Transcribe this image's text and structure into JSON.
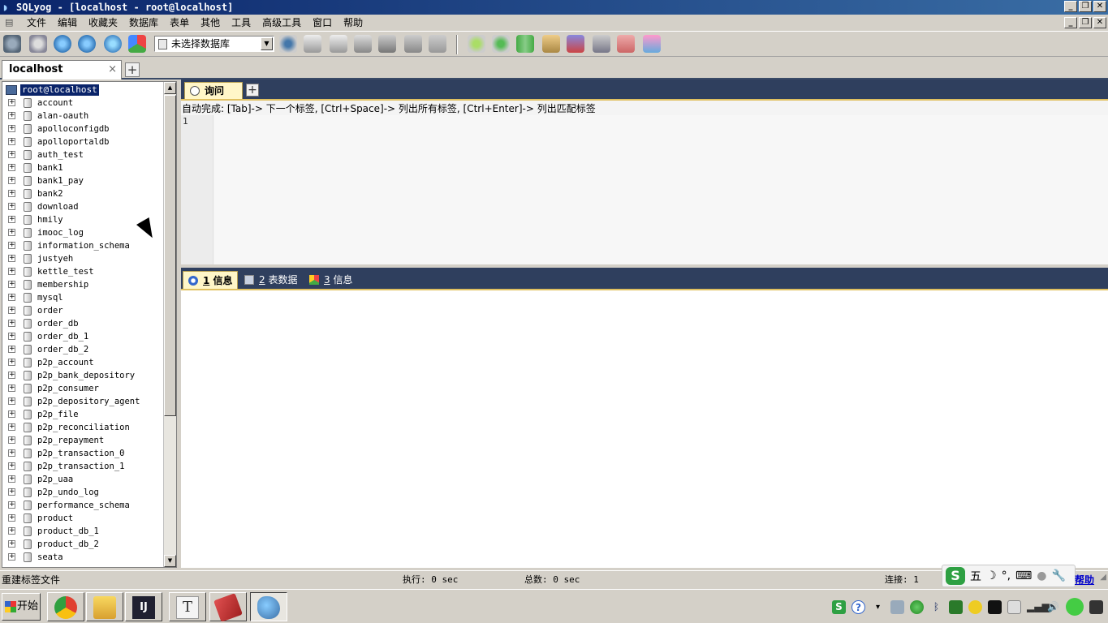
{
  "window": {
    "title": "SQLyog - [localhost - root@localhost]"
  },
  "menu": [
    "文件",
    "编辑",
    "收藏夹",
    "数据库",
    "表单",
    "其他",
    "工具",
    "高级工具",
    "窗口",
    "帮助"
  ],
  "toolbar": {
    "db_select_value": "未选择数据库"
  },
  "connection_tab": {
    "label": "localhost",
    "close": "×",
    "add": "+"
  },
  "tree": {
    "root": "root@localhost",
    "databases": [
      "account",
      "alan-oauth",
      "apolloconfigdb",
      "apolloportaldb",
      "auth_test",
      "bank1",
      "bank1_pay",
      "bank2",
      "download",
      "hmily",
      "imooc_log",
      "information_schema",
      "justyeh",
      "kettle_test",
      "membership",
      "mysql",
      "order",
      "order_db",
      "order_db_1",
      "order_db_2",
      "p2p_account",
      "p2p_bank_depository",
      "p2p_consumer",
      "p2p_depository_agent",
      "p2p_file",
      "p2p_reconciliation",
      "p2p_repayment",
      "p2p_transaction_0",
      "p2p_transaction_1",
      "p2p_uaa",
      "p2p_undo_log",
      "performance_schema",
      "product",
      "product_db_1",
      "product_db_2",
      "seata"
    ]
  },
  "query": {
    "tab_label": "询问",
    "add": "+",
    "autocomplete_hint": "自动完成: [Tab]-> 下一个标签, [Ctrl+Space]-> 列出所有标签, [Ctrl+Enter]-> 列出匹配标签",
    "line_number": "1"
  },
  "results": {
    "tabs": [
      {
        "num": "1",
        "label": "信息"
      },
      {
        "num": "2",
        "label": "表数据"
      },
      {
        "num": "3",
        "label": "信息"
      }
    ]
  },
  "status": {
    "left": "重建标签文件",
    "exec": "执行: 0 sec",
    "total": "总数: 0 sec",
    "conn": "连接: 1",
    "help": "帮助"
  },
  "ime": {
    "mode": "五",
    "logo": "S"
  },
  "taskbar": {
    "start": "开始",
    "items": [
      {
        "name": "chrome-task",
        "color": "#e04030"
      },
      {
        "name": "explorer-task",
        "color": "#e8b840"
      },
      {
        "name": "intellij-task",
        "color": "#202030"
      },
      {
        "name": "typora-task",
        "color": "#f0f0f0"
      },
      {
        "name": "eraser-task",
        "color": "#d04040"
      },
      {
        "name": "sqlyog-task",
        "color": "#3a6ea5"
      }
    ]
  },
  "colors": {
    "title_bg": "#0a246a",
    "pane_header": "#2f3f5e",
    "active_tab": "#fff6c8",
    "selection": "#0a246a"
  }
}
